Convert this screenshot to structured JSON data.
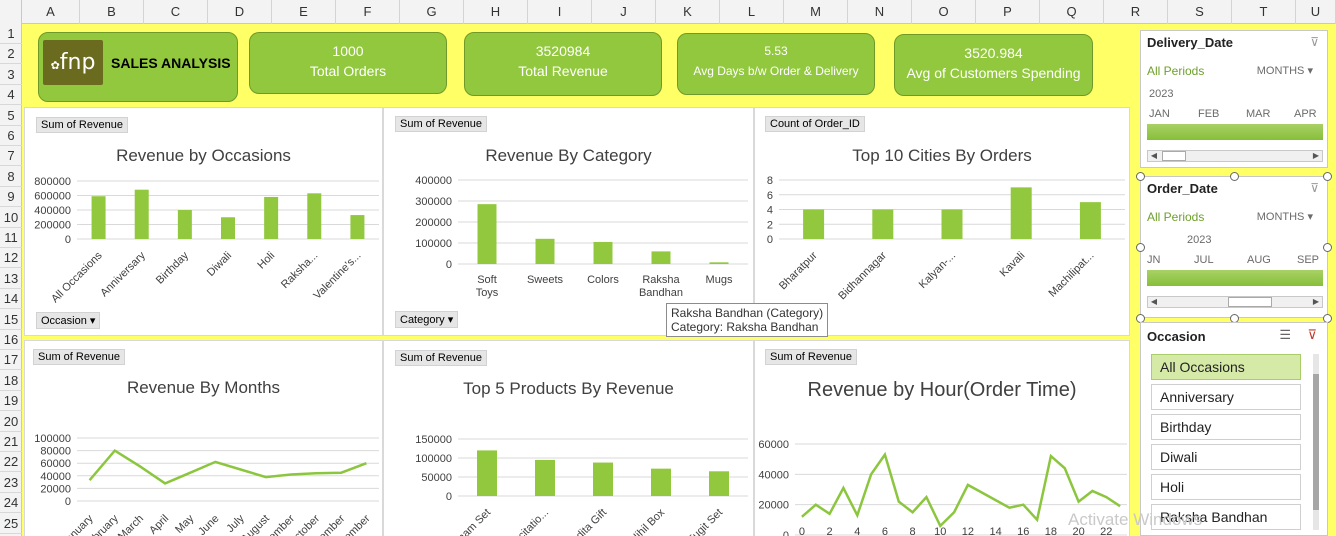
{
  "columns": [
    "A",
    "B",
    "C",
    "D",
    "E",
    "F",
    "G",
    "H",
    "I",
    "J",
    "K",
    "L",
    "M",
    "N",
    "O",
    "P",
    "Q",
    "R",
    "S",
    "T",
    "U"
  ],
  "rows": [
    "1",
    "2",
    "3",
    "4",
    "5",
    "6",
    "7",
    "8",
    "9",
    "10",
    "11",
    "12",
    "13",
    "14",
    "15",
    "16",
    "17",
    "18",
    "19",
    "20",
    "21",
    "22",
    "23",
    "24",
    "25"
  ],
  "logo": {
    "mark": "fnp",
    "title": "SALES ANALYSIS"
  },
  "kpis": [
    {
      "value": "1000",
      "label": "Total Orders"
    },
    {
      "value": "3520984",
      "label": "Total Revenue"
    },
    {
      "value": "5.53",
      "label": "Avg Days b/w Order & Delivery"
    },
    {
      "value": "3520.984",
      "label": "Avg of Customers Spending"
    }
  ],
  "charts": {
    "occasions": {
      "field": "Sum of Revenue",
      "filter": "Occasion",
      "title": "Revenue by Occasions",
      "chart_data": {
        "type": "bar",
        "categories": [
          "All Occasions",
          "Anniversary",
          "Birthday",
          "Diwali",
          "Holi",
          "Raksha...",
          "Valentine's..."
        ],
        "values": [
          590000,
          680000,
          400000,
          300000,
          580000,
          630000,
          330000
        ],
        "ylim": [
          0,
          800000
        ],
        "yticks": [
          "800000",
          "600000",
          "400000",
          "200000",
          "0"
        ]
      }
    },
    "category": {
      "field": "Sum of Revenue",
      "filter": "Category",
      "title": "Revenue By Category",
      "chart_data": {
        "type": "bar",
        "categories": [
          "Soft Toys",
          "Sweets",
          "Colors",
          "Raksha Bandhan",
          "Mugs"
        ],
        "values": [
          285000,
          120000,
          105000,
          60000,
          8000
        ],
        "ylim": [
          0,
          400000
        ],
        "yticks": [
          "400000",
          "300000",
          "200000",
          "100000",
          "0"
        ]
      }
    },
    "cities": {
      "field": "Count of Order_ID",
      "title": "Top 10 Cities By Orders",
      "chart_data": {
        "type": "bar",
        "categories": [
          "Bharatpur",
          "Bidhannagar",
          "Kalyan-...",
          "Kavali",
          "Machilipat..."
        ],
        "values": [
          4,
          4,
          4,
          7,
          5
        ],
        "ylim": [
          0,
          8
        ],
        "yticks": [
          "8",
          "6",
          "4",
          "2",
          "0"
        ]
      }
    },
    "months": {
      "field": "Sum of Revenue",
      "title": "Revenue By Months",
      "chart_data": {
        "type": "line",
        "categories": [
          "January",
          "February",
          "March",
          "April",
          "May",
          "June",
          "July",
          "August",
          "September",
          "October",
          "November",
          "December"
        ],
        "values": [
          33000,
          80000,
          55000,
          28000,
          45000,
          62000,
          50000,
          38000,
          42000,
          44000,
          45000,
          60000
        ],
        "ylim": [
          0,
          100000
        ],
        "yticks": [
          "100000",
          "80000",
          "60000",
          "40000",
          "20000",
          "0"
        ]
      }
    },
    "products": {
      "field": "Sum of Revenue",
      "title": "Top 5 Products By Revenue",
      "chart_data": {
        "type": "bar",
        "categories": [
          "Magnam Set",
          "Exercitatio...",
          "Expedita Gift",
          "Nihil Box",
          "Fugit Set"
        ],
        "values": [
          120000,
          95000,
          88000,
          72000,
          65000
        ],
        "ylim": [
          0,
          150000
        ],
        "yticks": [
          "150000",
          "100000",
          "50000",
          "0"
        ]
      }
    },
    "hours": {
      "field": "Sum of Revenue",
      "title": "Revenue by Hour(Order Time)",
      "chart_data": {
        "type": "line",
        "x": [
          0,
          1,
          2,
          3,
          4,
          5,
          6,
          7,
          8,
          9,
          10,
          11,
          12,
          13,
          14,
          15,
          16,
          17,
          18,
          19,
          20,
          21,
          22,
          23
        ],
        "values": [
          12000,
          20000,
          14000,
          31000,
          13000,
          40000,
          53000,
          22000,
          15000,
          25000,
          6000,
          15000,
          33000,
          28000,
          23000,
          18000,
          20000,
          10000,
          52000,
          44000,
          22000,
          29000,
          25000,
          19000
        ],
        "ylim": [
          0,
          60000
        ],
        "yticks": [
          "60000",
          "40000",
          "20000",
          "0"
        ],
        "xticks": [
          "0",
          "2",
          "4",
          "6",
          "8",
          "10",
          "12",
          "14",
          "16",
          "18",
          "20",
          "22"
        ]
      }
    }
  },
  "tooltip": {
    "line1": "Raksha Bandhan (Category)",
    "line2": "Category: Raksha Bandhan"
  },
  "slicers": {
    "delivery": {
      "title": "Delivery_Date",
      "period": "All Periods",
      "level": "MONTHS",
      "year": "2023",
      "months": [
        "JAN",
        "FEB",
        "MAR",
        "APR"
      ]
    },
    "order": {
      "title": "Order_Date",
      "period": "All Periods",
      "level": "MONTHS",
      "year": "2023",
      "months": [
        "JN",
        "JUL",
        "AUG",
        "SEP"
      ]
    },
    "occasion": {
      "title": "Occasion",
      "items": [
        "All Occasions",
        "Anniversary",
        "Birthday",
        "Diwali",
        "Holi",
        "Raksha Bandhan"
      ]
    }
  },
  "watermark": "Activate Windows",
  "colors": {
    "accent": "#92c83e",
    "sheet": "#ffff66",
    "line": "#8cc63f"
  }
}
